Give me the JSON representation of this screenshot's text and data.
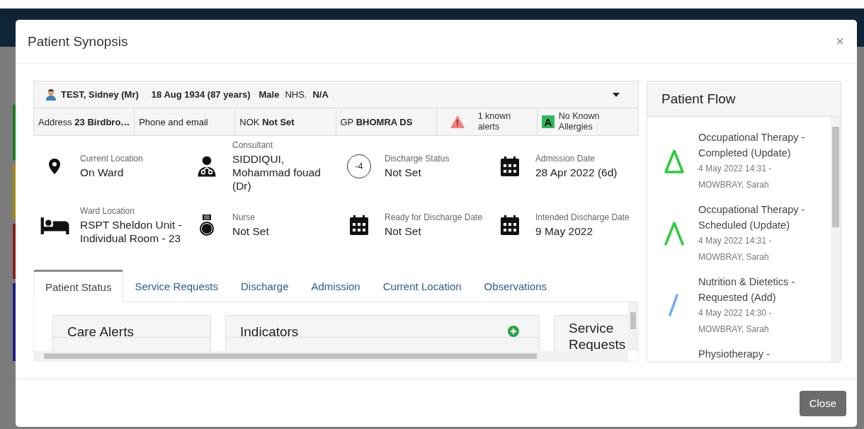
{
  "dialog": {
    "title": "Patient Synopsis",
    "close_symbol": "×"
  },
  "patient": {
    "name": "TEST, Sidney (Mr)",
    "dob": "18 Aug 1934 (87 years)",
    "sex": "Male",
    "nhs_label": "NHS.",
    "nhs": "N/A",
    "expanded": false
  },
  "details": [
    {
      "kind": "text",
      "label": "Address",
      "value": "23 Birdbro…"
    },
    {
      "kind": "text",
      "label": "Phone and email"
    },
    {
      "kind": "text",
      "label": "NOK",
      "value": "Not Set"
    },
    {
      "kind": "text",
      "label": "GP",
      "value": "BHOMRA DS"
    },
    {
      "kind": "alert",
      "label": "1 known alerts",
      "symbol": "!"
    },
    {
      "kind": "allergy",
      "label": "No Known Allergies",
      "symbol": "A"
    }
  ],
  "info": [
    {
      "kind": "location",
      "label": "Current Location",
      "value": "On Ward"
    },
    {
      "kind": "doctor",
      "label": "Consultant",
      "value": "SIDDIQUI, Mohammad fouad (Dr)"
    },
    {
      "kind": "count",
      "badge": "-4",
      "label": "Discharge Status",
      "value": "Not Set"
    },
    {
      "kind": "calendar",
      "label": "Admission Date",
      "value": "28 Apr 2022 (6d)"
    },
    {
      "kind": "bed",
      "label": "Ward Location",
      "value": "RSPT Sheldon Unit - Individual Room - 23"
    },
    {
      "kind": "nurse",
      "label": "Nurse",
      "value": "Not Set"
    },
    {
      "kind": "calendar",
      "label": "Ready for Discharge Date",
      "value": "Not Set"
    },
    {
      "kind": "calendar",
      "label": "Intended Discharge Date",
      "value": "9 May 2022"
    }
  ],
  "tabs": [
    {
      "label": "Patient Status",
      "selected": true
    },
    {
      "label": "Service Requests",
      "selected": false
    },
    {
      "label": "Discharge",
      "selected": false
    },
    {
      "label": "Admission",
      "selected": false
    },
    {
      "label": "Current Location",
      "selected": false
    },
    {
      "label": "Observations",
      "selected": false
    }
  ],
  "status_cards": [
    {
      "title": "Care Alerts",
      "add": false
    },
    {
      "title": "Indicators",
      "add": true
    },
    {
      "title": "Service Requests",
      "add": false
    }
  ],
  "patient_flow": {
    "title": "Patient Flow",
    "items": [
      {
        "kind": "completed",
        "title": "Occupational Therapy - Completed (Update)",
        "meta": "4 May 2022 14:31 - MOWBRAY, Sarah"
      },
      {
        "kind": "scheduled",
        "title": "Occupational Therapy - Scheduled (Update)",
        "meta": "4 May 2022 14:31 - MOWBRAY, Sarah"
      },
      {
        "kind": "requested",
        "title": "Nutrition & Dietetics - Requested (Add)",
        "meta": "4 May 2022 14:30 - MOWBRAY, Sarah"
      },
      {
        "kind": "none",
        "title": "Physiotherapy -"
      }
    ]
  },
  "footer": {
    "close_label": "Close"
  }
}
